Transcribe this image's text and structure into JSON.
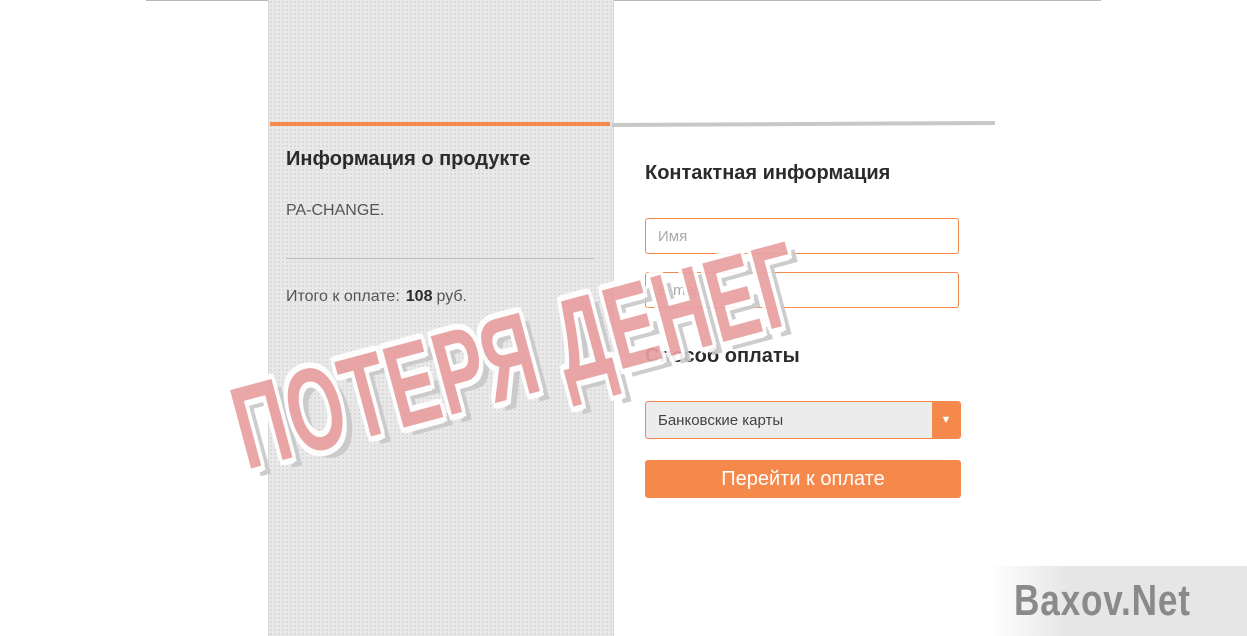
{
  "product": {
    "title": "Информация о продукте",
    "name": "PA-CHANGE.",
    "total_label": "Итого к оплате:",
    "total_value": "108",
    "currency": "руб."
  },
  "contact": {
    "title": "Контактная информация",
    "name_placeholder": "Имя",
    "email_placeholder": "E-mail"
  },
  "payment": {
    "title": "Способ оплаты",
    "method_selected": "Банковские карты",
    "submit_label": "Перейти к оплате"
  },
  "overlay": {
    "stamp_text": "ПОТЕРЯ ДЕНЕГ",
    "watermark": "Baxov.Net"
  },
  "colors": {
    "accent": "#f5894b",
    "stamp": "#e9a0a0"
  }
}
